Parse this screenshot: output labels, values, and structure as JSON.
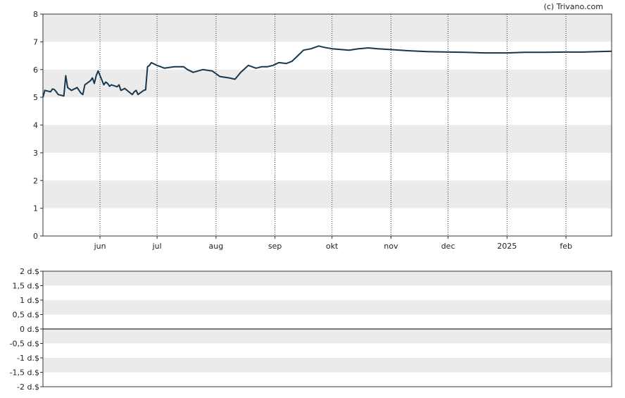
{
  "credit": "(c) Trivano.com",
  "colors": {
    "line": "#17374f",
    "band": "#ebebeb",
    "frame": "#333333",
    "zero_line": "#000000"
  },
  "chart_data": [
    {
      "type": "line",
      "title": "",
      "xlabel": "",
      "ylabel": "",
      "ylim": [
        0,
        8
      ],
      "y_ticks": [
        "0",
        "1",
        "2",
        "3",
        "4",
        "5",
        "6",
        "7",
        "8"
      ],
      "x_ticks": [
        "jun",
        "jul",
        "aug",
        "sep",
        "okt",
        "nov",
        "dec",
        "2025",
        "feb"
      ],
      "x_tick_dates": [
        "2024-06-01",
        "2024-07-01",
        "2024-08-01",
        "2024-09-01",
        "2024-10-01",
        "2024-11-01",
        "2024-12-01",
        "2025-01-01",
        "2025-02-01"
      ],
      "xlim": [
        "2024-05-02",
        "2025-02-25"
      ],
      "grid": "alternating horizontal bands, dotted vertical lines at month ticks",
      "series": [
        {
          "x": [
            "2024-05-02",
            "2024-05-03",
            "2024-05-06",
            "2024-05-07",
            "2024-05-08",
            "2024-05-09",
            "2024-05-10",
            "2024-05-13",
            "2024-05-14",
            "2024-05-15",
            "2024-05-16",
            "2024-05-17",
            "2024-05-20",
            "2024-05-21",
            "2024-05-22",
            "2024-05-23",
            "2024-05-24",
            "2024-05-27",
            "2024-05-28",
            "2024-05-29",
            "2024-05-30",
            "2024-05-31",
            "2024-06-03",
            "2024-06-04",
            "2024-06-05",
            "2024-06-06",
            "2024-06-07",
            "2024-06-10",
            "2024-06-11",
            "2024-06-12",
            "2024-06-13",
            "2024-06-14",
            "2024-06-17",
            "2024-06-18",
            "2024-06-19",
            "2024-06-20",
            "2024-06-21",
            "2024-06-24",
            "2024-06-25",
            "2024-06-26",
            "2024-06-27",
            "2024-06-28",
            "2024-07-01",
            "2024-07-05",
            "2024-07-10",
            "2024-07-15",
            "2024-07-17",
            "2024-07-20",
            "2024-07-25",
            "2024-07-30",
            "2024-08-03",
            "2024-08-08",
            "2024-08-11",
            "2024-08-14",
            "2024-08-18",
            "2024-08-22",
            "2024-08-25",
            "2024-08-28",
            "2024-08-31",
            "2024-09-03",
            "2024-09-07",
            "2024-09-10",
            "2024-09-13",
            "2024-09-16",
            "2024-09-20",
            "2024-09-24",
            "2024-09-27",
            "2024-10-01",
            "2024-10-06",
            "2024-10-10",
            "2024-10-15",
            "2024-10-20",
            "2024-10-25",
            "2024-11-01",
            "2024-11-10",
            "2024-11-20",
            "2024-12-01",
            "2024-12-10",
            "2024-12-20",
            "2025-01-01",
            "2025-01-10",
            "2025-01-20",
            "2025-02-01",
            "2025-02-10",
            "2025-02-18",
            "2025-02-25"
          ],
          "y": [
            5.0,
            5.25,
            5.2,
            5.3,
            5.28,
            5.2,
            5.1,
            5.05,
            5.78,
            5.35,
            5.3,
            5.25,
            5.35,
            5.25,
            5.15,
            5.1,
            5.45,
            5.6,
            5.7,
            5.5,
            5.78,
            5.95,
            5.45,
            5.55,
            5.5,
            5.4,
            5.45,
            5.38,
            5.45,
            5.25,
            5.28,
            5.32,
            5.15,
            5.1,
            5.2,
            5.25,
            5.1,
            5.25,
            5.27,
            6.1,
            6.15,
            6.25,
            6.15,
            6.05,
            6.1,
            6.1,
            6.0,
            5.9,
            6.0,
            5.95,
            5.75,
            5.7,
            5.65,
            5.9,
            6.15,
            6.05,
            6.1,
            6.1,
            6.15,
            6.25,
            6.22,
            6.3,
            6.5,
            6.7,
            6.75,
            6.85,
            6.8,
            6.75,
            6.72,
            6.7,
            6.75,
            6.78,
            6.75,
            6.72,
            6.68,
            6.65,
            6.63,
            6.62,
            6.6,
            6.6,
            6.62,
            6.62,
            6.63,
            6.63,
            6.65,
            6.66
          ]
        }
      ]
    },
    {
      "type": "line",
      "title": "",
      "ylim": [
        -2,
        2
      ],
      "y_ticks": [
        "2 d.$",
        "1,5 d.$",
        "1 d.$",
        "0,5 d.$",
        "0 d.$",
        "-0,5 d.$",
        "-1 d.$",
        "-1,5 d.$",
        "-2 d.$"
      ],
      "grid": "alternating horizontal bands",
      "series": []
    }
  ]
}
